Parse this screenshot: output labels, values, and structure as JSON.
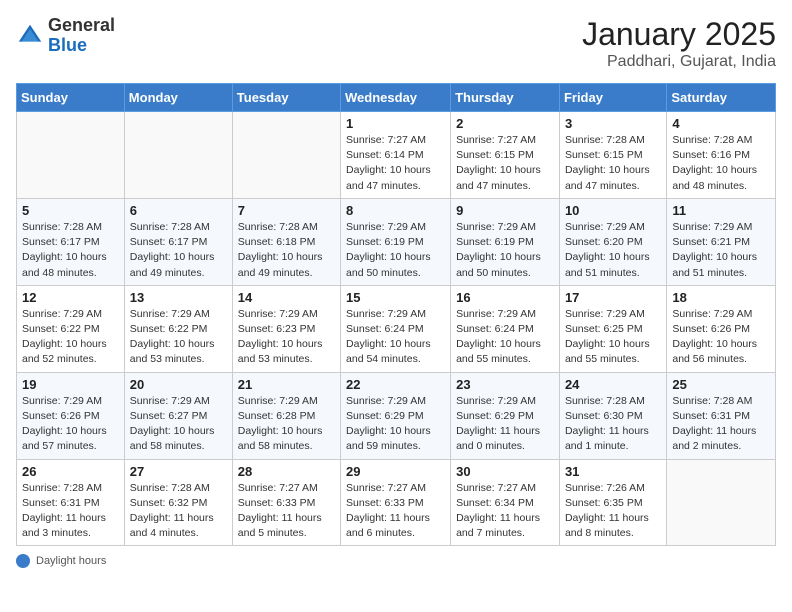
{
  "header": {
    "logo_general": "General",
    "logo_blue": "Blue",
    "month_title": "January 2025",
    "location": "Paddhari, Gujarat, India"
  },
  "days_of_week": [
    "Sunday",
    "Monday",
    "Tuesday",
    "Wednesday",
    "Thursday",
    "Friday",
    "Saturday"
  ],
  "footer": {
    "note": "Daylight hours"
  },
  "weeks": [
    [
      {
        "day": "",
        "info": ""
      },
      {
        "day": "",
        "info": ""
      },
      {
        "day": "",
        "info": ""
      },
      {
        "day": "1",
        "info": "Sunrise: 7:27 AM\nSunset: 6:14 PM\nDaylight: 10 hours\nand 47 minutes."
      },
      {
        "day": "2",
        "info": "Sunrise: 7:27 AM\nSunset: 6:15 PM\nDaylight: 10 hours\nand 47 minutes."
      },
      {
        "day": "3",
        "info": "Sunrise: 7:28 AM\nSunset: 6:15 PM\nDaylight: 10 hours\nand 47 minutes."
      },
      {
        "day": "4",
        "info": "Sunrise: 7:28 AM\nSunset: 6:16 PM\nDaylight: 10 hours\nand 48 minutes."
      }
    ],
    [
      {
        "day": "5",
        "info": "Sunrise: 7:28 AM\nSunset: 6:17 PM\nDaylight: 10 hours\nand 48 minutes."
      },
      {
        "day": "6",
        "info": "Sunrise: 7:28 AM\nSunset: 6:17 PM\nDaylight: 10 hours\nand 49 minutes."
      },
      {
        "day": "7",
        "info": "Sunrise: 7:28 AM\nSunset: 6:18 PM\nDaylight: 10 hours\nand 49 minutes."
      },
      {
        "day": "8",
        "info": "Sunrise: 7:29 AM\nSunset: 6:19 PM\nDaylight: 10 hours\nand 50 minutes."
      },
      {
        "day": "9",
        "info": "Sunrise: 7:29 AM\nSunset: 6:19 PM\nDaylight: 10 hours\nand 50 minutes."
      },
      {
        "day": "10",
        "info": "Sunrise: 7:29 AM\nSunset: 6:20 PM\nDaylight: 10 hours\nand 51 minutes."
      },
      {
        "day": "11",
        "info": "Sunrise: 7:29 AM\nSunset: 6:21 PM\nDaylight: 10 hours\nand 51 minutes."
      }
    ],
    [
      {
        "day": "12",
        "info": "Sunrise: 7:29 AM\nSunset: 6:22 PM\nDaylight: 10 hours\nand 52 minutes."
      },
      {
        "day": "13",
        "info": "Sunrise: 7:29 AM\nSunset: 6:22 PM\nDaylight: 10 hours\nand 53 minutes."
      },
      {
        "day": "14",
        "info": "Sunrise: 7:29 AM\nSunset: 6:23 PM\nDaylight: 10 hours\nand 53 minutes."
      },
      {
        "day": "15",
        "info": "Sunrise: 7:29 AM\nSunset: 6:24 PM\nDaylight: 10 hours\nand 54 minutes."
      },
      {
        "day": "16",
        "info": "Sunrise: 7:29 AM\nSunset: 6:24 PM\nDaylight: 10 hours\nand 55 minutes."
      },
      {
        "day": "17",
        "info": "Sunrise: 7:29 AM\nSunset: 6:25 PM\nDaylight: 10 hours\nand 55 minutes."
      },
      {
        "day": "18",
        "info": "Sunrise: 7:29 AM\nSunset: 6:26 PM\nDaylight: 10 hours\nand 56 minutes."
      }
    ],
    [
      {
        "day": "19",
        "info": "Sunrise: 7:29 AM\nSunset: 6:26 PM\nDaylight: 10 hours\nand 57 minutes."
      },
      {
        "day": "20",
        "info": "Sunrise: 7:29 AM\nSunset: 6:27 PM\nDaylight: 10 hours\nand 58 minutes."
      },
      {
        "day": "21",
        "info": "Sunrise: 7:29 AM\nSunset: 6:28 PM\nDaylight: 10 hours\nand 58 minutes."
      },
      {
        "day": "22",
        "info": "Sunrise: 7:29 AM\nSunset: 6:29 PM\nDaylight: 10 hours\nand 59 minutes."
      },
      {
        "day": "23",
        "info": "Sunrise: 7:29 AM\nSunset: 6:29 PM\nDaylight: 11 hours\nand 0 minutes."
      },
      {
        "day": "24",
        "info": "Sunrise: 7:28 AM\nSunset: 6:30 PM\nDaylight: 11 hours\nand 1 minute."
      },
      {
        "day": "25",
        "info": "Sunrise: 7:28 AM\nSunset: 6:31 PM\nDaylight: 11 hours\nand 2 minutes."
      }
    ],
    [
      {
        "day": "26",
        "info": "Sunrise: 7:28 AM\nSunset: 6:31 PM\nDaylight: 11 hours\nand 3 minutes."
      },
      {
        "day": "27",
        "info": "Sunrise: 7:28 AM\nSunset: 6:32 PM\nDaylight: 11 hours\nand 4 minutes."
      },
      {
        "day": "28",
        "info": "Sunrise: 7:27 AM\nSunset: 6:33 PM\nDaylight: 11 hours\nand 5 minutes."
      },
      {
        "day": "29",
        "info": "Sunrise: 7:27 AM\nSunset: 6:33 PM\nDaylight: 11 hours\nand 6 minutes."
      },
      {
        "day": "30",
        "info": "Sunrise: 7:27 AM\nSunset: 6:34 PM\nDaylight: 11 hours\nand 7 minutes."
      },
      {
        "day": "31",
        "info": "Sunrise: 7:26 AM\nSunset: 6:35 PM\nDaylight: 11 hours\nand 8 minutes."
      },
      {
        "day": "",
        "info": ""
      }
    ]
  ]
}
